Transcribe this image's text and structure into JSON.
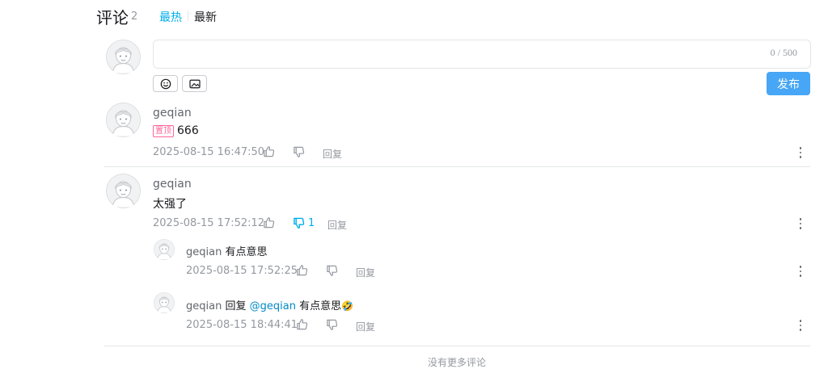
{
  "header": {
    "title": "评论",
    "count": "2",
    "sort_hot": "最热",
    "sort_new": "最新"
  },
  "composer": {
    "word_count": "0 / 500",
    "emoji_icon": "smile-icon",
    "image_icon": "image-icon",
    "publish_label": "发布"
  },
  "comments": [
    {
      "username": "geqian",
      "pinned_label": "置顶",
      "text": "666",
      "time": "2025-08-15 16:47:50",
      "dislike_count": "",
      "reply_label": "回复"
    },
    {
      "username": "geqian",
      "text": "太强了",
      "time": "2025-08-15 17:52:12",
      "dislike_count": "1",
      "reply_label": "回复",
      "replies": [
        {
          "username": "geqian",
          "text": "有点意思",
          "time": "2025-08-15 17:52:25",
          "reply_label": "回复"
        },
        {
          "username": "geqian",
          "reply_word": "回复",
          "mention": "@geqian",
          "text": "有点意思",
          "emoji": "🤣",
          "time": "2025-08-15 18:44:41",
          "reply_label": "回复"
        }
      ]
    }
  ],
  "footer": {
    "note": "没有更多评论"
  },
  "colors": {
    "accent": "#00aeec",
    "publish": "#47a6f5",
    "pin": "#ff6699",
    "mention": "#008ac5"
  }
}
